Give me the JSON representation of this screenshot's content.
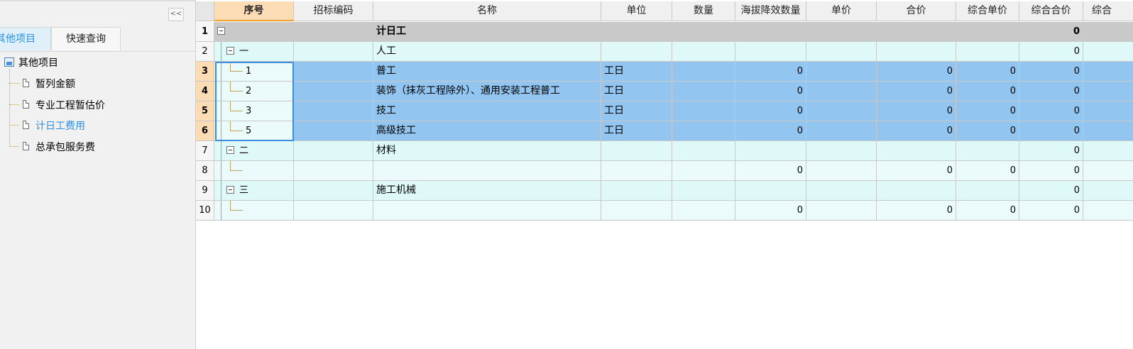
{
  "left_panel": {
    "collapse_label": "<<",
    "tabs": [
      "其他项目",
      "快速查询"
    ],
    "tree": {
      "root": "其他项目",
      "items": [
        "暂列金额",
        "专业工程暂估价",
        "计日工费用",
        "总承包服务费"
      ]
    },
    "colors": {
      "active_tab_text": "#2d8fe0",
      "selected_item_text": "#2d8fe0"
    }
  },
  "grid": {
    "columns": [
      "序号",
      "招标编码",
      "名称",
      "单位",
      "数量",
      "海拔降效数量",
      "单价",
      "合价",
      "综合单价",
      "综合合价",
      "综合"
    ],
    "rows": [
      {
        "no": "1",
        "seq": "",
        "code": "",
        "name": "计日工",
        "unit": "",
        "qty": "",
        "alt_qty": "",
        "price": "",
        "total": "",
        "comp_price": "",
        "comp_total": "0"
      },
      {
        "no": "2",
        "seq": "一",
        "code": "",
        "name": "人工",
        "unit": "",
        "qty": "",
        "alt_qty": "",
        "price": "",
        "total": "",
        "comp_price": "",
        "comp_total": "0"
      },
      {
        "no": "3",
        "seq": "1",
        "code": "",
        "name": "普工",
        "unit": "工日",
        "qty": "",
        "alt_qty": "0",
        "price": "",
        "total": "0",
        "comp_price": "0",
        "comp_total": "0"
      },
      {
        "no": "4",
        "seq": "2",
        "code": "",
        "name": "装饰（抹灰工程除外）、通用安装工程普工",
        "unit": "工日",
        "qty": "",
        "alt_qty": "0",
        "price": "",
        "total": "0",
        "comp_price": "0",
        "comp_total": "0"
      },
      {
        "no": "5",
        "seq": "3",
        "code": "",
        "name": "技工",
        "unit": "工日",
        "qty": "",
        "alt_qty": "0",
        "price": "",
        "total": "0",
        "comp_price": "0",
        "comp_total": "0"
      },
      {
        "no": "6",
        "seq": "5",
        "code": "",
        "name": "高级技工",
        "unit": "工日",
        "qty": "",
        "alt_qty": "0",
        "price": "",
        "total": "0",
        "comp_price": "0",
        "comp_total": "0"
      },
      {
        "no": "7",
        "seq": "二",
        "code": "",
        "name": "材料",
        "unit": "",
        "qty": "",
        "alt_qty": "",
        "price": "",
        "total": "",
        "comp_price": "",
        "comp_total": "0"
      },
      {
        "no": "8",
        "seq": "",
        "code": "",
        "name": "",
        "unit": "",
        "qty": "",
        "alt_qty": "0",
        "price": "",
        "total": "0",
        "comp_price": "0",
        "comp_total": "0"
      },
      {
        "no": "9",
        "seq": "三",
        "code": "",
        "name": "施工机械",
        "unit": "",
        "qty": "",
        "alt_qty": "",
        "price": "",
        "total": "",
        "comp_price": "",
        "comp_total": "0"
      },
      {
        "no": "10",
        "seq": "",
        "code": "",
        "name": "",
        "unit": "",
        "qty": "",
        "alt_qty": "0",
        "price": "",
        "total": "0",
        "comp_price": "0",
        "comp_total": "0"
      }
    ],
    "colors": {
      "header_active": "#fbdcb4",
      "row_summary": "#c9c9c9",
      "row_group": "#dff8f8",
      "row_selected": "#92c5f0",
      "selection_border": "#3c8de0"
    }
  }
}
